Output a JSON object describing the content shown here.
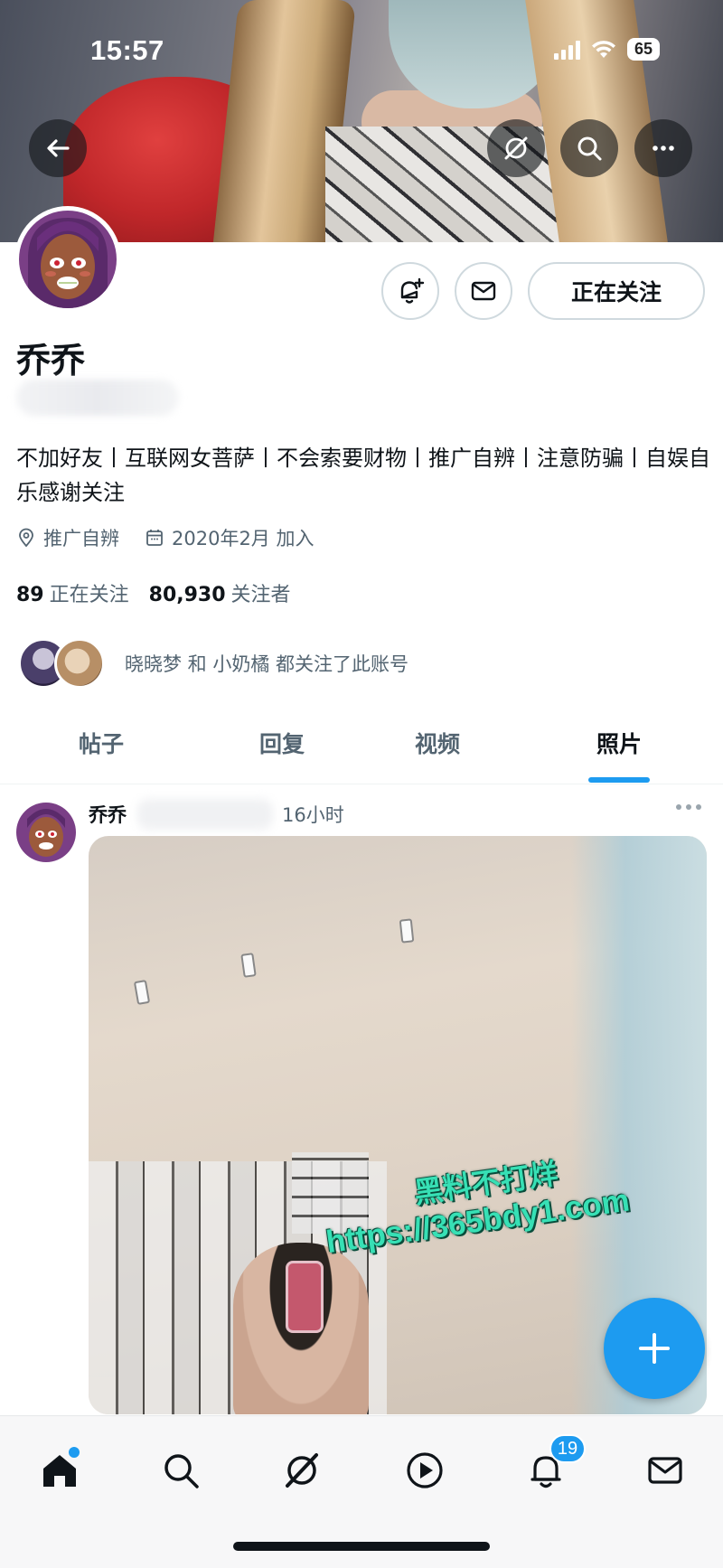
{
  "status_bar": {
    "time": "15:57",
    "battery": "65"
  },
  "profile": {
    "name": "乔乔",
    "bio": "不加好友丨互联网女菩萨丨不会索要财物丨推广自辨丨注意防骗丨自娱自乐感谢关注",
    "location": "推广自辨",
    "joined": "2020年2月 加入",
    "following_count": "89",
    "following_label": "正在关注",
    "followers_count": "80,930",
    "followers_label": "关注者",
    "mutuals_text": "晓晓梦 和 小奶橘 都关注了此账号",
    "follow_button_label": "正在关注"
  },
  "tabs": [
    {
      "label": "帖子",
      "active": false
    },
    {
      "label": "回复",
      "active": false
    },
    {
      "label": "视频",
      "active": false
    },
    {
      "label": "照片",
      "active": true
    }
  ],
  "post": {
    "author": "乔乔",
    "time": "16小时"
  },
  "watermark": {
    "line1": "黑料不打烊",
    "line2": "https://365bdy1.com"
  },
  "bottom_nav": {
    "items": [
      "home-icon",
      "search-icon",
      "grok-icon",
      "play-icon",
      "bell-icon",
      "mail-icon"
    ],
    "notification_count": "19"
  },
  "colors": {
    "accent": "#1d9bf0",
    "text": "#0f1419",
    "muted": "#536471"
  }
}
